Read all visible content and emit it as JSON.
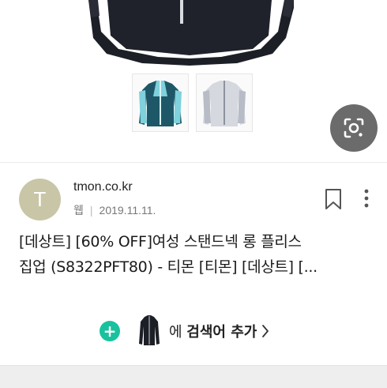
{
  "source": {
    "avatar_letter": "T",
    "site": "tmon.co.kr",
    "type": "웹",
    "date": "2019.11.11."
  },
  "result": {
    "title_line1": "[데상트] [60% OFF]여성 스탠드넥 롱 플리스",
    "title_line2": "집업 (S8322PFT80) - 티몬 [티몬] [데상트] [..."
  },
  "add_keyword": {
    "prefix": "에",
    "label": "검색어 추가"
  },
  "colors": {
    "accent_green": "#19c29e",
    "avatar_bg": "#c8c6a7",
    "lens_button": "#6b6b6b"
  },
  "icons": [
    "lens-icon",
    "bookmark-icon",
    "more-vert-icon",
    "plus-icon",
    "chevron-right-icon"
  ]
}
